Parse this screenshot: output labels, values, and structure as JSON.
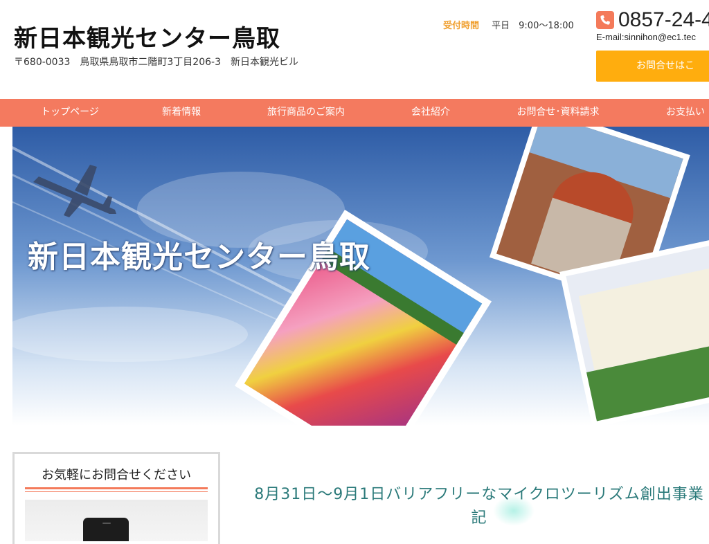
{
  "header": {
    "site_title": "新日本観光センター鳥取",
    "address": "〒680-0033　鳥取県鳥取市二階町3丁目206-3　新日本観光ビル",
    "hours_label": "受付時間",
    "hours_value": "平日　9:00〜18:00",
    "phone": "0857-24-4",
    "email": "E-mail:sinnihon@ec1.tec",
    "contact_button": "お問合せはこ"
  },
  "nav": {
    "items": [
      "トップページ",
      "新着情報",
      "旅行商品のご案内",
      "会社紹介",
      "お問合せ･資料請求",
      "お支払い"
    ]
  },
  "hero": {
    "title": "新日本観光センター鳥取"
  },
  "sidebar": {
    "title": "お気軽にお問合せください"
  },
  "article": {
    "title_line1": "8月31日〜9月1日バリアフリーなマイクロツーリズム創出事業",
    "title_line2": "記"
  },
  "colors": {
    "nav_bg": "#f47a5f",
    "accent_orange": "#ffad0e",
    "hours_label": "#f0a030",
    "article_title": "#2b7a7a"
  }
}
